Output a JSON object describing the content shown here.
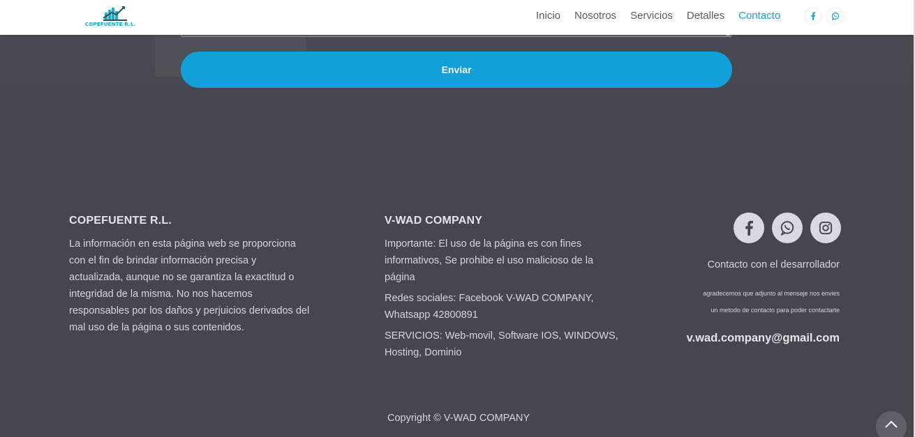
{
  "brand": {
    "logo_text": "COPEFUENTE R.L.",
    "accent": "#139fd9"
  },
  "nav": {
    "links": [
      "Inicio",
      "Nosotros",
      "Servicios",
      "Detalles",
      "Contacto"
    ],
    "active": "Contacto",
    "social_icons": [
      "facebook-icon",
      "whatsapp-icon"
    ]
  },
  "form": {
    "submit_label": "Enviar"
  },
  "footer": {
    "col1": {
      "title": "COPEFUENTE R.L.",
      "text_lines": [
        "La información en esta página web se proporciona",
        "con el fin de brindar información precisa y",
        "actualizada, aunque no se garantiza la exactitud o",
        "integridad de la misma. No nos hacemos",
        "responsables por los daños y perjuicios derivados del",
        "mal uso de la página o sus contenidos."
      ]
    },
    "col2": {
      "title": "V-WAD COMPANY",
      "para1_lines": [
        "Importante: El uso de la página es con fines",
        "informativos, Se prohibe el uso malicioso de la",
        "página"
      ],
      "para2_lines": [
        "Redes sociales: Facebook V-WAD COMPANY,",
        "Whatsapp 42800891"
      ],
      "para3_lines": [
        "SERVICIOS: Web-movil, Software IOS, WINDOWS,",
        "Hosting, Dominio"
      ]
    },
    "col3": {
      "social_icons": [
        "facebook-icon",
        "whatsapp-icon",
        "instagram-icon"
      ],
      "dev_title": "Contacto con el desarrollador",
      "note_line1": "agradecemos que adjunto al mensaje nos envies",
      "note_line2": "un metodo de contacto para poder contactarte",
      "email": "v.wad.company@gmail.com"
    },
    "copyright": "Copyright © V-WAD COMPANY"
  }
}
